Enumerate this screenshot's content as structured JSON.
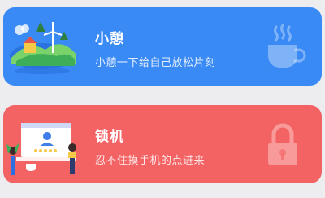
{
  "cards": [
    {
      "title": "小憩",
      "subtitle": "小憩一下给自己放松片刻",
      "illustration": "landscape-windmill-illustration",
      "icon": "coffee-cup-icon",
      "background": "#3a8af5"
    },
    {
      "title": "锁机",
      "subtitle": "忍不住摸手机的点进来",
      "illustration": "person-computer-illustration",
      "icon": "padlock-icon",
      "background": "#f46364"
    }
  ]
}
